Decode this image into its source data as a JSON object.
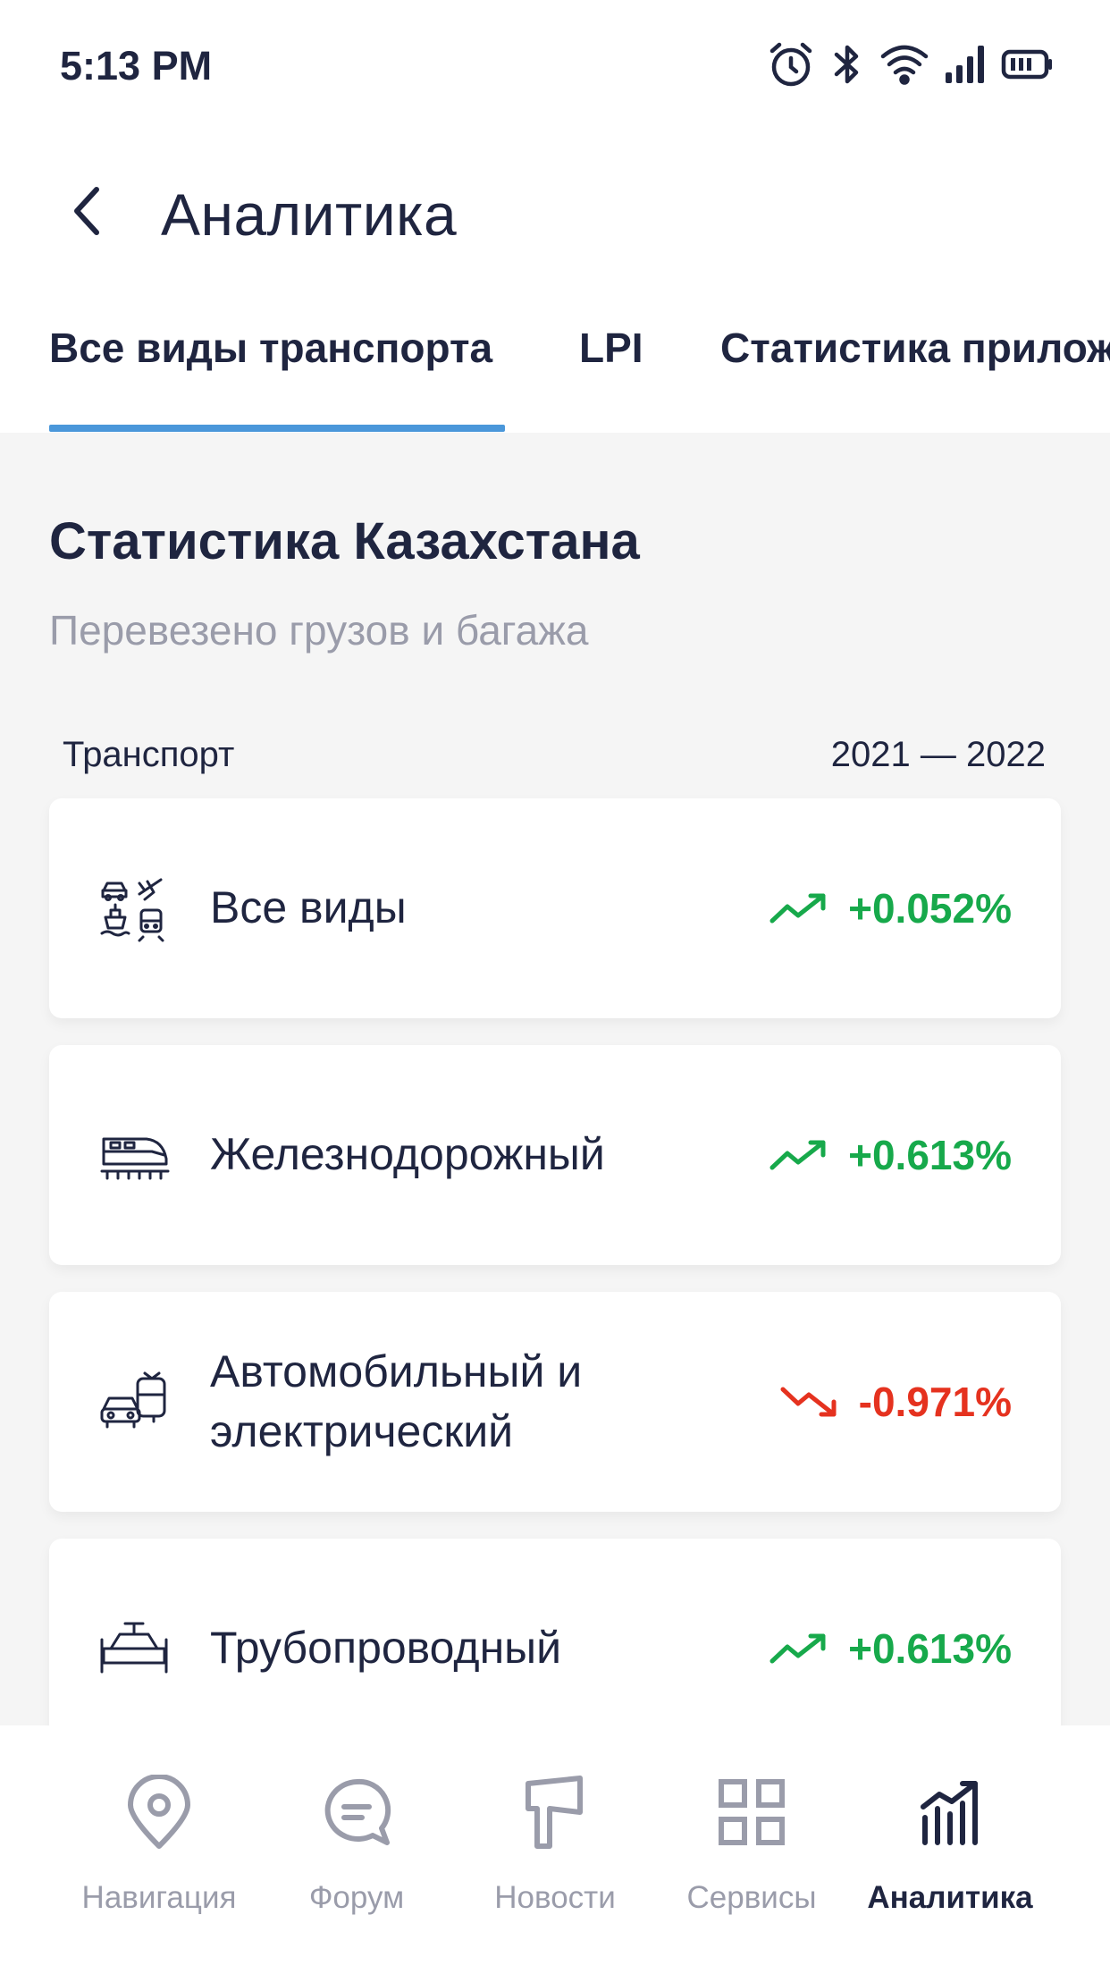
{
  "status_bar": {
    "time": "5:13 PM",
    "icons": [
      "alarm-icon",
      "bluetooth-icon",
      "wifi-icon",
      "signal-icon",
      "battery-icon"
    ]
  },
  "app_bar": {
    "back_icon": "back-arrow-icon",
    "title": "Аналитика"
  },
  "tabs": [
    {
      "label": "Все виды транспорта",
      "active": true
    },
    {
      "label": "LPI",
      "active": false
    },
    {
      "label": "Статистика прилож",
      "active": false
    }
  ],
  "section": {
    "title": "Статистика Казахстана",
    "subtitle": "Перевезено грузов и багажа",
    "col_left": "Транспорт",
    "col_right": "2021 — 2022"
  },
  "rows": [
    {
      "icon": "all-transport-icon",
      "label": "Все виды",
      "value": "+0.052%",
      "direction": "up"
    },
    {
      "icon": "train-icon",
      "label": "Железнодорожный",
      "value": "+0.613%",
      "direction": "up"
    },
    {
      "icon": "car-bus-icon",
      "label": "Автомобильный и электрический",
      "value": "-0.971%",
      "direction": "down"
    },
    {
      "icon": "pipeline-icon",
      "label": "Трубопроводный",
      "value": "+0.613%",
      "direction": "up"
    }
  ],
  "bottom_nav": [
    {
      "icon": "location-pin-icon",
      "label": "Навигация",
      "active": false
    },
    {
      "icon": "chat-bubble-icon",
      "label": "Форум",
      "active": false
    },
    {
      "icon": "megaphone-icon",
      "label": "Новости",
      "active": false
    },
    {
      "icon": "grid-icon",
      "label": "Сервисы",
      "active": false
    },
    {
      "icon": "analytics-chart-icon",
      "label": "Аналитика",
      "active": true
    }
  ],
  "colors": {
    "accent": "#4a97da",
    "positive": "#17a94b",
    "negative": "#e5321f",
    "text_primary": "#1f2540",
    "text_secondary": "#9a9caa",
    "background": "#f5f5f5"
  }
}
